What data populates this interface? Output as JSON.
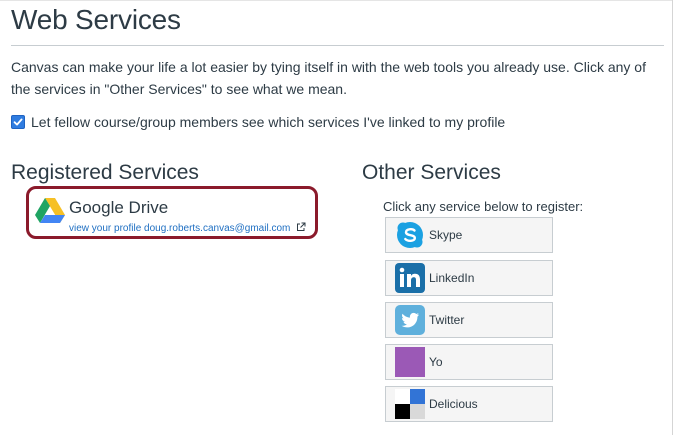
{
  "page": {
    "title": "Web Services",
    "intro": "Canvas can make your life a lot easier by tying itself in with the web tools you already use. Click any of the services in \"Other Services\" to see what we mean.",
    "checkbox_label": "Let fellow course/group members see which services I've linked to my profile",
    "checkbox_checked": true
  },
  "registered": {
    "title": "Registered Services",
    "service": {
      "name": "Google Drive",
      "link": "view your profile doug.roberts.canvas@gmail.com",
      "icon": "google-drive-icon"
    }
  },
  "other": {
    "title": "Other Services",
    "prompt": "Click any service below to register:",
    "services": [
      {
        "label": "Skype",
        "icon": "skype-icon",
        "color": "#1ba1e2"
      },
      {
        "label": "LinkedIn",
        "icon": "linkedin-icon",
        "color": "#1a6fa8"
      },
      {
        "label": "Twitter",
        "icon": "twitter-icon",
        "color": "#5fb0dc"
      },
      {
        "label": "Yo",
        "icon": "yo-icon",
        "color": "#9b59b6"
      },
      {
        "label": "Delicious",
        "icon": "delicious-icon",
        "color": "#3274d6"
      }
    ]
  }
}
